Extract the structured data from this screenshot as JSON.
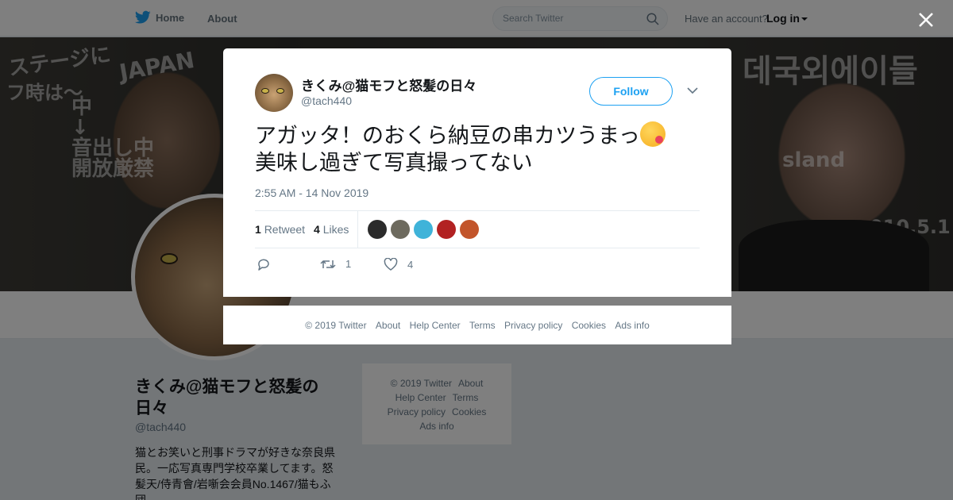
{
  "topbar": {
    "home_label": "Home",
    "about_label": "About",
    "search_placeholder": "Search Twitter",
    "account_prompt": "Have an account?",
    "login_label": "Log in"
  },
  "profile": {
    "name": "きくみ@猫モフと怒髪の日々",
    "handle": "@tach440",
    "bio": "猫とお笑いと刑事ドラマが好きな奈良県民。一応写真専門学校卒業してます。怒髪天/侍青會/岩噺会会員No.1467/猫もふ団"
  },
  "side_footer": {
    "copyright": "© 2019 Twitter",
    "about": "About",
    "help": "Help Center",
    "terms": "Terms",
    "privacy": "Privacy policy",
    "cookies": "Cookies",
    "ads": "Ads info"
  },
  "tweet": {
    "author_name": "きくみ@猫モフと怒髪の日々",
    "author_handle": "@tach440",
    "follow_label": "Follow",
    "text_line1": "アガッタ！のおくら納豆の串カツうまっ",
    "text_line2": "美味し過ぎて写真撮ってない",
    "timestamp": "2:55 AM - 14 Nov 2019",
    "retweet_count": "1",
    "retweet_label": "Retweet",
    "like_count": "4",
    "like_label": "Likes",
    "action_retweet_count": "1",
    "action_like_count": "4",
    "liker_colors": [
      "#2b2b2b",
      "#6d6a5e",
      "#3fb3d9",
      "#b22222",
      "#c2552b"
    ]
  },
  "modal_footer": {
    "copyright": "© 2019 Twitter",
    "about": "About",
    "help": "Help Center",
    "terms": "Terms",
    "privacy": "Privacy policy",
    "cookies": "Cookies",
    "ads": "Ads info"
  },
  "colors": {
    "accent": "#1da1f2",
    "overlay": "rgba(0,0,0,0.5)"
  }
}
